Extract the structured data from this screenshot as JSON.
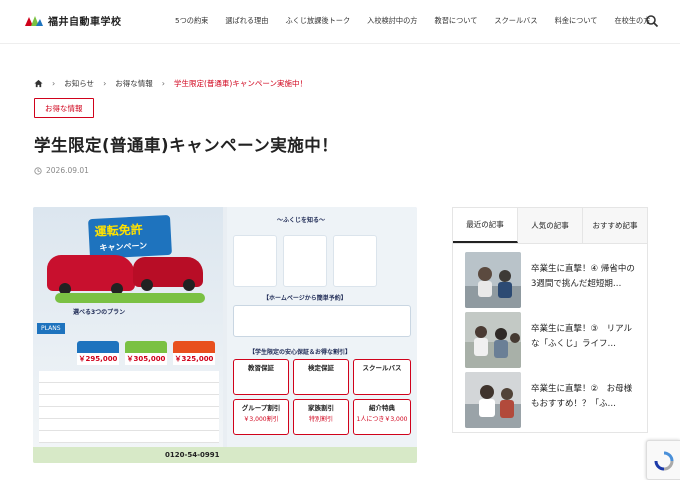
{
  "header": {
    "logo_text": "福井自動車学校",
    "nav": [
      "5つの約束",
      "選ばれる理由",
      "ふくじ放課後トーク",
      "入校検討中の方",
      "教習について",
      "スクールバス",
      "料金について",
      "在校生の方"
    ],
    "search_icon": "search-icon"
  },
  "breadcrumb": {
    "home_icon": "home-icon",
    "items": [
      "お知らせ",
      "お得な情報",
      "学生限定(普通車)キャンペーン実施中！"
    ]
  },
  "post": {
    "category": "お得な情報",
    "title": "学生限定(普通車)キャンペーン実施中！",
    "date": "2026.09.01",
    "date_icon": "clock-icon"
  },
  "flyer": {
    "banner_main": "運転免許",
    "banner_sub": "キャンペーン",
    "plans_label": "PLANS",
    "plans_title": "選べる3つのプラン",
    "plan_prices": [
      "￥295,000",
      "￥305,000",
      "￥325,000"
    ],
    "plan_colors": [
      "#1e73be",
      "#7ac143",
      "#e8501e"
    ],
    "right_title": "〜ふくじを知る〜",
    "reserve_title": "【ホームページから簡単予約】",
    "guarantee_title": "【学生限定の安心保証＆お得な割引】",
    "badges": [
      "教習保証",
      "検定保証",
      "スクールバス",
      "グループ割引",
      "家族割引",
      "紹介特典"
    ],
    "badge_values": [
      "",
      "",
      "",
      "￥3,000割引",
      "特別割引",
      "1人につき￥3,000"
    ],
    "phone": "0120-54-0991",
    "accent": "#d0021b",
    "brand_blue": "#1e73be"
  },
  "sidebar": {
    "tabs": [
      "最近の記事",
      "人気の記事",
      "おすすめ記事"
    ],
    "active_tab": "最近の記事",
    "posts": [
      {
        "title": "卒業生に直撃！④ 帰省中の3週間で挑んだ超短期…"
      },
      {
        "title": "卒業生に直撃！③　リアルな「ふくじ」ライフ…"
      },
      {
        "title": "卒業生に直撃！②　お母様もおすすめ！？「ふ…"
      }
    ]
  }
}
